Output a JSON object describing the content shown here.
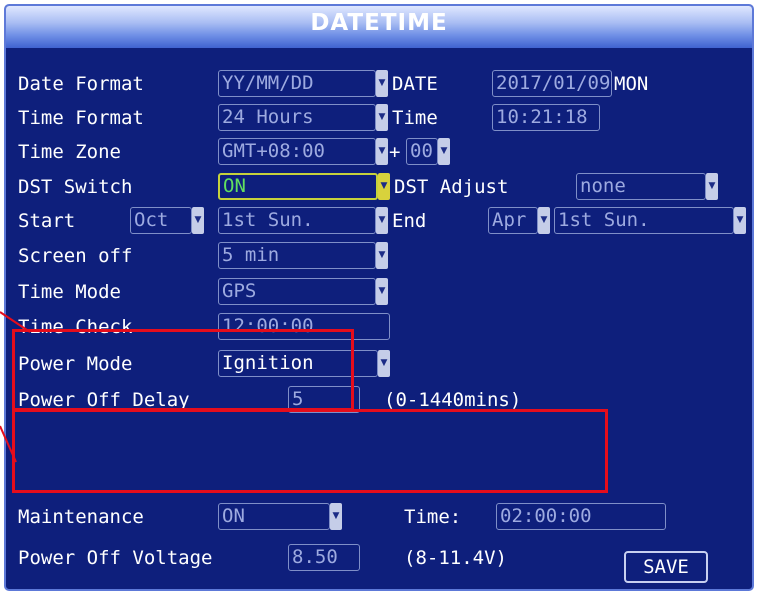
{
  "title": "DATETIME",
  "fields": {
    "date_format": {
      "label": "Date Format",
      "value": "YY/MM/DD"
    },
    "date": {
      "label": "DATE",
      "value": "2017/01/09",
      "weekday": "MON"
    },
    "time_format": {
      "label": "Time Format",
      "value": "24 Hours"
    },
    "time": {
      "label": "Time",
      "value": "10:21:18"
    },
    "time_zone": {
      "label": "Time Zone",
      "value": "GMT+08:00",
      "plus": "+",
      "minutes": "00"
    },
    "dst_switch": {
      "label": "DST Switch",
      "value": "ON"
    },
    "dst_adjust": {
      "label": "DST Adjust",
      "value": "none"
    },
    "start": {
      "label": "Start",
      "month": "Oct",
      "week": "1st Sun."
    },
    "end": {
      "label": "End",
      "month": "Apr",
      "week": "1st Sun."
    },
    "screen_off": {
      "label": "Screen off",
      "value": "5 min"
    },
    "time_mode": {
      "label": "Time Mode",
      "value": "GPS"
    },
    "time_check": {
      "label": "Time Check",
      "value": "12:00:00"
    },
    "power_mode": {
      "label": "Power Mode",
      "value": "Ignition"
    },
    "power_off_delay": {
      "label": "Power Off Delay",
      "value": "5",
      "hint": "(0-1440mins)"
    },
    "maintenance": {
      "label": "Maintenance",
      "value": "ON",
      "time_label": "Time:",
      "time_value": "02:00:00"
    },
    "power_off_voltage": {
      "label": "Power Off Voltage",
      "value": "8.50",
      "hint": "(8-11.4V)"
    }
  },
  "save_label": "SAVE",
  "colors": {
    "background": "#0e1f7c",
    "highlight": "#e50d1c",
    "active_border": "#c6d23c",
    "active_text": "#62e05f"
  },
  "icons": {
    "dropdown": "chevron-down-icon"
  }
}
